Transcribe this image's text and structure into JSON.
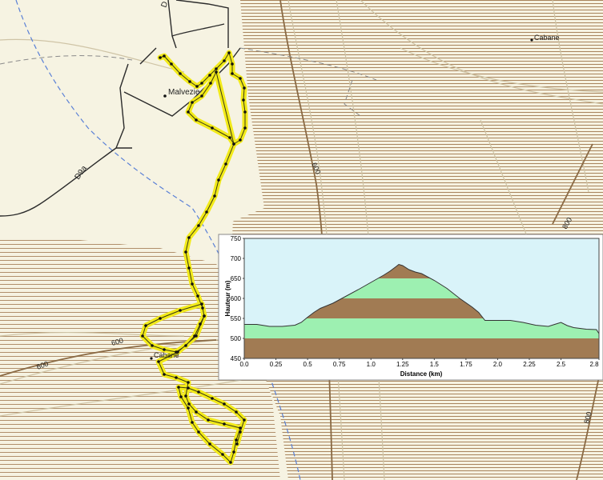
{
  "map": {
    "places": {
      "town": "Malvezie",
      "shelter_top": "Cabane",
      "shelter_bottom": "Cabane"
    },
    "road_label": "D9a",
    "road_label_top": "D",
    "contours": {
      "c600_center": "600",
      "c600_left_a": "600",
      "c600_left_b": "600",
      "c800_right_a": "800",
      "c800_right_b": "800"
    },
    "colors": {
      "background": "#f6f3e2",
      "hatch": "#a8845c",
      "contour": "#cfc4a6",
      "route": "#f2ea1a",
      "road": "#2b2b2b",
      "stream": "#5a80d6"
    }
  },
  "chart_data": {
    "type": "area",
    "title": "",
    "xlabel": "Distance  (km)",
    "ylabel": "Hauteur (m)",
    "xlim": [
      0,
      2.8
    ],
    "ylim": [
      450,
      750
    ],
    "x_ticks": [
      "0.0",
      "0.25",
      "0.5",
      "0.75",
      "1.0",
      "1.25",
      "1.5",
      "1.75",
      "2.0",
      "2.25",
      "2.5",
      "2.8"
    ],
    "y_ticks": [
      "450",
      "500",
      "550",
      "600",
      "650",
      "700",
      "750"
    ],
    "band_colors": [
      "#a17b53",
      "#9df0b1"
    ],
    "plot_background": "#d9f3f9",
    "series": [
      {
        "x": [
          0,
          0.1,
          0.2,
          0.3,
          0.4,
          0.45,
          0.5,
          0.55,
          0.6,
          0.7,
          0.8,
          0.9,
          1.0,
          1.1,
          1.15,
          1.2,
          1.22,
          1.25,
          1.3,
          1.35,
          1.4,
          1.5,
          1.6,
          1.7,
          1.8,
          1.85,
          1.9,
          2.0,
          2.1,
          2.2,
          2.3,
          2.4,
          2.45,
          2.5,
          2.55,
          2.6,
          2.7,
          2.78,
          2.8
        ],
        "y": [
          535,
          535,
          530,
          530,
          533,
          540,
          553,
          565,
          575,
          588,
          605,
          622,
          640,
          658,
          668,
          680,
          685,
          682,
          672,
          666,
          662,
          645,
          625,
          600,
          578,
          565,
          545,
          545,
          545,
          540,
          533,
          530,
          535,
          540,
          532,
          527,
          523,
          522,
          512
        ]
      }
    ]
  }
}
